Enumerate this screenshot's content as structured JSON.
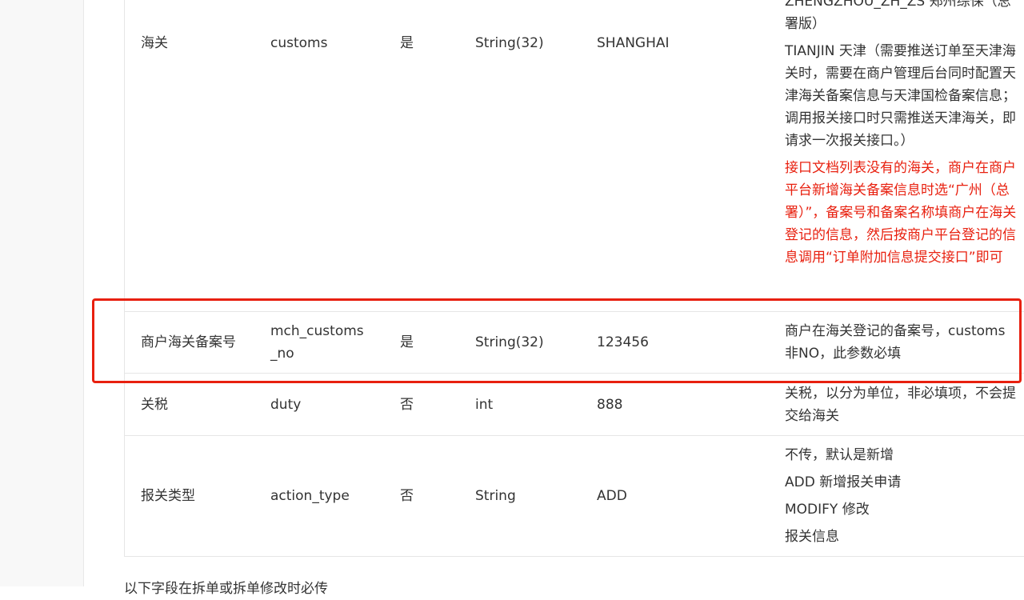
{
  "rows": [
    {
      "name": "海关",
      "field": "customs",
      "required": "是",
      "type": "String(32)",
      "sample": "SHANGHAI",
      "desc": [
        "ZHENGZHOU_ZH_ZS 郑州综保（总署版）",
        "TIANJIN 天津（需要推送订单至天津海关时，需要在商户管理后台同时配置天津海关备案信息与天津国检备案信息；调用报关接口时只需推送天津海关，即请求一次报关接口。）"
      ],
      "note": "接口文档列表没有的海关，商户在商户平台新增海关备案信息时选“广州（总署）”，备案号和备案名称填商户在海关登记的信息，然后按商户平台登记的信息调用“订单附加信息提交接口”即可"
    },
    {
      "name": "商户海关备案号",
      "field": "mch_customs_no",
      "required": "是",
      "type": "String(32)",
      "sample": "123456",
      "desc": [
        "商户在海关登记的备案号，customs非NO，此参数必填"
      ]
    },
    {
      "name": "关税",
      "field": "duty",
      "required": "否",
      "type": "int",
      "sample": "888",
      "desc": [
        "关税，以分为单位，非必填项，不会提交给海关"
      ]
    },
    {
      "name": "报关类型",
      "field": "action_type",
      "required": "否",
      "type": "String",
      "sample": "ADD",
      "desc": [
        "不传，默认是新增",
        "ADD 新增报关申请",
        "MODIFY 修改",
        "报关信息"
      ]
    }
  ],
  "highlight_color": "#e8200f",
  "note_color": "#e8200f",
  "bottom_text": "以下字段在拆单或拆单修改时必传"
}
